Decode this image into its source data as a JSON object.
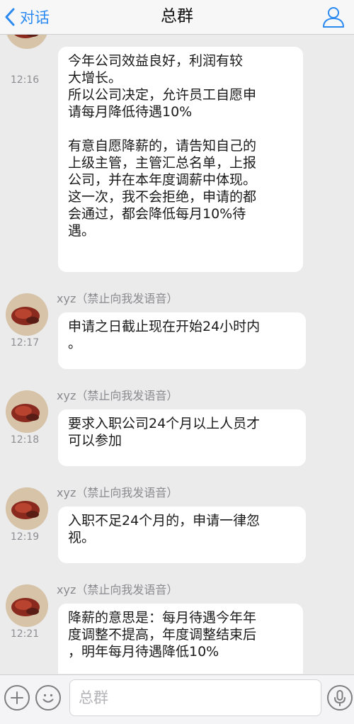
{
  "nav": {
    "back_label": "对话",
    "title": "总群",
    "back_icon": "chevron-left-icon",
    "profile_icon": "person-icon",
    "accent_color": "#2b8af0"
  },
  "messages": [
    {
      "sender": "",
      "time": "12:16",
      "lines": [
        "今年公司效益良好，利润有较",
        "大增长。",
        "所以公司决定，允许员工自愿申",
        "请每月降低待遇10%",
        "",
        "有意自愿降薪的，请告知自己的",
        "上级主管，主管汇总名单，上报",
        "公司，并在本年度调薪中体现。",
        "这一次，我不会拒绝，申请的都",
        "会通过，都会降低每月10%待",
        "遇。"
      ]
    },
    {
      "sender": "xyz（禁止向我发语音）",
      "time": "12:17",
      "lines": [
        "申请之日截止现在开始24小时内",
        "。"
      ]
    },
    {
      "sender": "xyz（禁止向我发语音）",
      "time": "12:18",
      "lines": [
        "要求入职公司24个月以上人员才",
        "可以参加"
      ]
    },
    {
      "sender": "xyz（禁止向我发语音）",
      "time": "12:19",
      "lines": [
        "入职不足24个月的，申请一律忽",
        "视。"
      ]
    },
    {
      "sender": "xyz（禁止向我发语音）",
      "time": "12:21",
      "lines": [
        "降薪的意思是：每月待遇今年年",
        "度调整不提高，年度调整结束后",
        "，明年每月待遇降低10%"
      ]
    }
  ],
  "input": {
    "placeholder": "总群",
    "add_icon": "plus-icon",
    "emoji_icon": "emoji-icon",
    "voice_icon": "microphone-icon"
  }
}
